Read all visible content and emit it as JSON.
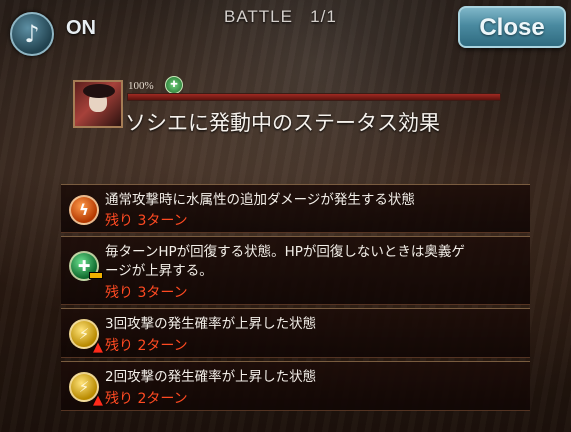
{
  "top_bar": {
    "music_icon": "music-note-icon",
    "sound_toggle": "ON",
    "battle_label": "BATTLE",
    "battle_count": "1/1",
    "close_label": "Close"
  },
  "character": {
    "hp_percent": "100",
    "hp_fraction": 1.0,
    "panel_title": "ソシエに発動中のステータス効果"
  },
  "effects": [
    {
      "icon": "water-bonus-damage-icon",
      "text": "通常攻撃時に水属性の追加ダメージが発生する状態",
      "turns": "残り 3ターン"
    },
    {
      "icon": "regen-icon",
      "text_line1": "毎ターンHPが回復する状態。HPが回復しないときは奥義ゲ",
      "text_line2": "ージが上昇する。",
      "turns": "残り 3ターン"
    },
    {
      "icon": "triple-attack-up-icon",
      "text": "3回攻撃の発生確率が上昇した状態",
      "turns": "残り 2ターン"
    },
    {
      "icon": "double-attack-up-icon",
      "text": "2回攻撃の発生確率が上昇した状態",
      "turns": "残り 2ターン"
    }
  ]
}
